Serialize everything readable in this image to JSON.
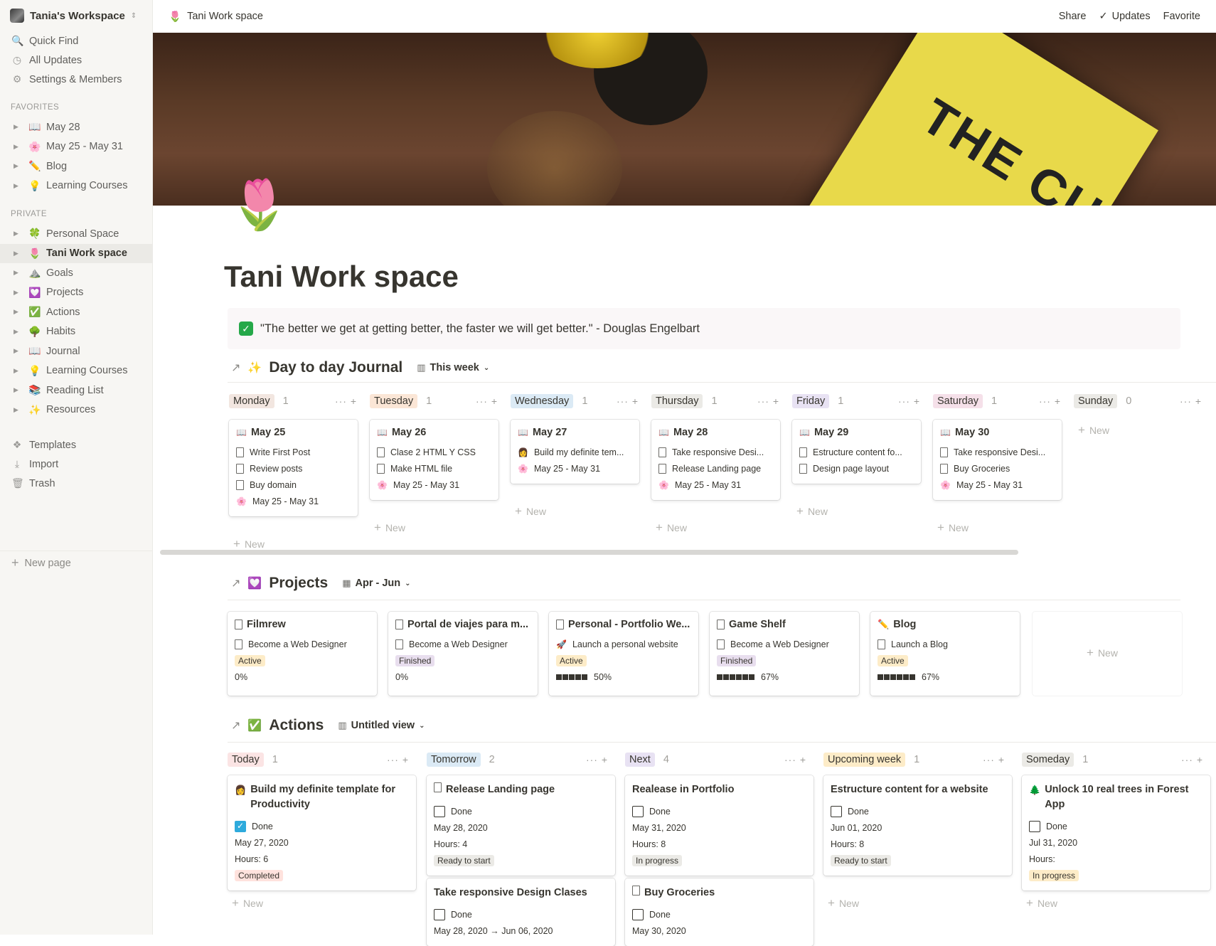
{
  "sidebar": {
    "workspace": "Tania's Workspace",
    "links": [
      {
        "icon": "search-icon",
        "glyph": "🔍",
        "label": "Quick Find"
      },
      {
        "icon": "clock-icon",
        "glyph": "◷",
        "label": "All Updates"
      },
      {
        "icon": "gear-icon",
        "glyph": "⚙",
        "label": "Settings & Members"
      }
    ],
    "favorites_label": "FAVORITES",
    "favorites": [
      {
        "emoji": "📖",
        "label": "May 28"
      },
      {
        "emoji": "🌸",
        "label": "May 25 - May 31"
      },
      {
        "emoji": "✏️",
        "label": "Blog"
      },
      {
        "emoji": "💡",
        "label": "Learning Courses"
      }
    ],
    "private_label": "PRIVATE",
    "private": [
      {
        "emoji": "🍀",
        "label": "Personal Space"
      },
      {
        "emoji": "🌷",
        "label": "Tani Work space"
      },
      {
        "emoji": "⛰️",
        "label": "Goals"
      },
      {
        "emoji": "💟",
        "label": "Projects"
      },
      {
        "emoji": "✅",
        "label": "Actions"
      },
      {
        "emoji": "🌳",
        "label": "Habits"
      },
      {
        "emoji": "📖",
        "label": "Journal"
      },
      {
        "emoji": "💡",
        "label": "Learning Courses"
      },
      {
        "emoji": "📚",
        "label": "Reading List"
      },
      {
        "emoji": "✨",
        "label": "Resources"
      }
    ],
    "bottom": [
      {
        "icon": "templates-icon",
        "glyph": "❖",
        "label": "Templates"
      },
      {
        "icon": "import-icon",
        "glyph": "⤓",
        "label": "Import"
      },
      {
        "icon": "trash-icon",
        "glyph": "🗑",
        "label": "Trash"
      }
    ],
    "new_page": "New page"
  },
  "topbar": {
    "crumb_emoji": "🌷",
    "crumb": "Tani Work space",
    "share": "Share",
    "updates": "Updates",
    "favorite": "Favorite"
  },
  "page": {
    "emoji": "🌷",
    "title": "Tani Work space",
    "quote": "\"The better we get at getting better, the faster we will get better.\" - Douglas Engelbart",
    "quote_check": "✓",
    "cover_book_text": "THE CULTURE MAP"
  },
  "journal": {
    "emoji": "✨",
    "title": "Day to day Journal",
    "view": "This week",
    "new_label": "New",
    "columns": [
      {
        "day": "Monday",
        "count": "1",
        "bg": "#f2e6e0",
        "card": {
          "title": "May 25",
          "rows": [
            {
              "e": "doc",
              "t": "Write First Post"
            },
            {
              "e": "doc",
              "t": "Review posts"
            },
            {
              "e": "doc",
              "t": "Buy domain"
            },
            {
              "e": "🌸",
              "t": "May 25 - May 31"
            }
          ]
        }
      },
      {
        "day": "Tuesday",
        "count": "1",
        "bg": "#fbe6d6",
        "card": {
          "title": "May 26",
          "rows": [
            {
              "e": "doc",
              "t": "Clase 2 HTML Y CSS"
            },
            {
              "e": "doc",
              "t": "Make HTML file"
            },
            {
              "e": "🌸",
              "t": "May 25 - May 31"
            }
          ]
        }
      },
      {
        "day": "Wednesday",
        "count": "1",
        "bg": "#dbeaf5",
        "card": {
          "title": "May 27",
          "rows": [
            {
              "e": "👩",
              "t": "Build my definite tem..."
            },
            {
              "e": "🌸",
              "t": "May 25 - May 31"
            }
          ]
        }
      },
      {
        "day": "Thursday",
        "count": "1",
        "bg": "#ebeae6",
        "card": {
          "title": "May 28",
          "rows": [
            {
              "e": "doc",
              "t": "Take responsive Desi..."
            },
            {
              "e": "doc",
              "t": "Release Landing page"
            },
            {
              "e": "🌸",
              "t": "May 25 - May 31"
            }
          ]
        }
      },
      {
        "day": "Friday",
        "count": "1",
        "bg": "#e8e2f3",
        "card": {
          "title": "May 29",
          "rows": [
            {
              "e": "doc",
              "t": "Estructure content fo..."
            },
            {
              "e": "doc",
              "t": "Design page layout"
            }
          ]
        }
      },
      {
        "day": "Saturday",
        "count": "1",
        "bg": "#f5e0e9",
        "card": {
          "title": "May 30",
          "rows": [
            {
              "e": "doc",
              "t": "Take responsive Desi..."
            },
            {
              "e": "doc",
              "t": "Buy Groceries"
            },
            {
              "e": "🌸",
              "t": "May 25 - May 31"
            }
          ]
        }
      },
      {
        "day": "Sunday",
        "count": "0",
        "bg": "#ebeae6",
        "card": null
      }
    ]
  },
  "projects": {
    "emoji": "💟",
    "title": "Projects",
    "view": "Apr - Jun",
    "new_label": "New",
    "cards": [
      {
        "title": "Filmrew",
        "goal_emoji": "doc",
        "goal": "Become a Web Designer",
        "status": "Active",
        "status_bg": "#fdecc8",
        "progress": "0%",
        "blocks": 0
      },
      {
        "title": "Portal de viajes para m...",
        "goal_emoji": "doc",
        "goal": "Become a Web Designer",
        "status": "Finished",
        "status_bg": "#e8deee",
        "progress": "0%",
        "blocks": 0
      },
      {
        "title": "Personal - Portfolio We...",
        "goal_emoji": "🚀",
        "goal": "Launch a personal website",
        "status": "Active",
        "status_bg": "#fdecc8",
        "progress": "50%",
        "blocks": 5
      },
      {
        "title": "Game Shelf",
        "goal_emoji": "doc",
        "goal": "Become a Web Designer",
        "status": "Finished",
        "status_bg": "#e8deee",
        "progress": "67%",
        "blocks": 6
      },
      {
        "title": "Blog",
        "title_emoji": "✏️",
        "goal_emoji": "doc",
        "goal": "Launch a Blog",
        "status": "Active",
        "status_bg": "#fdecc8",
        "progress": "67%",
        "blocks": 6
      }
    ]
  },
  "actions": {
    "emoji": "✅",
    "title": "Actions",
    "view": "Untitled view",
    "new_label": "New",
    "done_label": "Done",
    "columns": [
      {
        "name": "Today",
        "count": "1",
        "bg": "#fbe4e4",
        "cards": [
          {
            "emoji": "👩",
            "title": "Build my definite template for Productivity",
            "done": true,
            "date": "May 27, 2020",
            "hours": "Hours: 6",
            "status": "Completed",
            "status_bg": "#ffe2dd"
          }
        ]
      },
      {
        "name": "Tomorrow",
        "count": "2",
        "bg": "#dbeaf5",
        "cards": [
          {
            "emoji": "doc",
            "title": "Release Landing page",
            "done": false,
            "date": "May 28, 2020",
            "hours": "Hours: 4",
            "status": "Ready to start",
            "status_bg": "#ebeae6"
          },
          {
            "emoji": "",
            "title": "Take responsive Design Clases",
            "done": false,
            "date": "May 28, 2020 → Jun 06, 2020",
            "hours": "",
            "status": "",
            "status_bg": ""
          }
        ]
      },
      {
        "name": "Next",
        "count": "4",
        "bg": "#e8e2f3",
        "cards": [
          {
            "emoji": "",
            "title": "Realease in Portfolio",
            "done": false,
            "date": "May 31, 2020",
            "hours": "Hours: 8",
            "status": "In progress",
            "status_bg": "#ebeae6"
          },
          {
            "emoji": "doc",
            "title": "Buy Groceries",
            "done": false,
            "date": "May 30, 2020",
            "hours": "",
            "status": "",
            "status_bg": ""
          }
        ]
      },
      {
        "name": "Upcoming week",
        "count": "1",
        "bg": "#fdecc8",
        "cards": [
          {
            "emoji": "",
            "title": "Estructure content for a website",
            "done": false,
            "date": "Jun 01, 2020",
            "hours": "Hours: 8",
            "status": "Ready to start",
            "status_bg": "#ebeae6"
          }
        ]
      },
      {
        "name": "Someday",
        "count": "1",
        "bg": "#ebeae6",
        "cards": [
          {
            "emoji": "🌲",
            "title": "Unlock 10 real trees in Forest App",
            "done": false,
            "date": "Jul 31, 2020",
            "hours": "Hours:",
            "status": "In progress",
            "status_bg": "#fdecc8"
          }
        ]
      }
    ]
  }
}
